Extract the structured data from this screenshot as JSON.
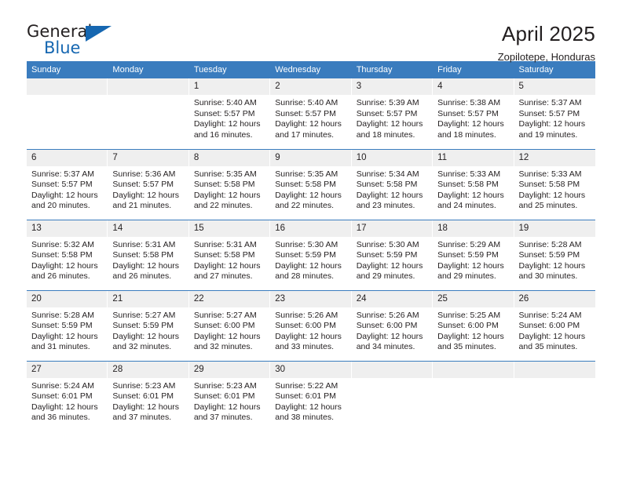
{
  "brand": {
    "name_top": "General",
    "name_bottom": "Blue",
    "accent_color": "#1667b1"
  },
  "header": {
    "title": "April 2025",
    "subtitle": "Zopilotepe, Honduras"
  },
  "theme": {
    "header_blue": "#3a7cbe",
    "daynum_gray": "#efefef",
    "text": "#231f20"
  },
  "calendar": {
    "weekday_headers": [
      "Sunday",
      "Monday",
      "Tuesday",
      "Wednesday",
      "Thursday",
      "Friday",
      "Saturday"
    ],
    "weeks": [
      [
        {
          "day": "",
          "lines": []
        },
        {
          "day": "",
          "lines": []
        },
        {
          "day": "1",
          "lines": [
            "Sunrise: 5:40 AM",
            "Sunset: 5:57 PM",
            "Daylight: 12 hours",
            "and 16 minutes."
          ]
        },
        {
          "day": "2",
          "lines": [
            "Sunrise: 5:40 AM",
            "Sunset: 5:57 PM",
            "Daylight: 12 hours",
            "and 17 minutes."
          ]
        },
        {
          "day": "3",
          "lines": [
            "Sunrise: 5:39 AM",
            "Sunset: 5:57 PM",
            "Daylight: 12 hours",
            "and 18 minutes."
          ]
        },
        {
          "day": "4",
          "lines": [
            "Sunrise: 5:38 AM",
            "Sunset: 5:57 PM",
            "Daylight: 12 hours",
            "and 18 minutes."
          ]
        },
        {
          "day": "5",
          "lines": [
            "Sunrise: 5:37 AM",
            "Sunset: 5:57 PM",
            "Daylight: 12 hours",
            "and 19 minutes."
          ]
        }
      ],
      [
        {
          "day": "6",
          "lines": [
            "Sunrise: 5:37 AM",
            "Sunset: 5:57 PM",
            "Daylight: 12 hours",
            "and 20 minutes."
          ]
        },
        {
          "day": "7",
          "lines": [
            "Sunrise: 5:36 AM",
            "Sunset: 5:57 PM",
            "Daylight: 12 hours",
            "and 21 minutes."
          ]
        },
        {
          "day": "8",
          "lines": [
            "Sunrise: 5:35 AM",
            "Sunset: 5:58 PM",
            "Daylight: 12 hours",
            "and 22 minutes."
          ]
        },
        {
          "day": "9",
          "lines": [
            "Sunrise: 5:35 AM",
            "Sunset: 5:58 PM",
            "Daylight: 12 hours",
            "and 22 minutes."
          ]
        },
        {
          "day": "10",
          "lines": [
            "Sunrise: 5:34 AM",
            "Sunset: 5:58 PM",
            "Daylight: 12 hours",
            "and 23 minutes."
          ]
        },
        {
          "day": "11",
          "lines": [
            "Sunrise: 5:33 AM",
            "Sunset: 5:58 PM",
            "Daylight: 12 hours",
            "and 24 minutes."
          ]
        },
        {
          "day": "12",
          "lines": [
            "Sunrise: 5:33 AM",
            "Sunset: 5:58 PM",
            "Daylight: 12 hours",
            "and 25 minutes."
          ]
        }
      ],
      [
        {
          "day": "13",
          "lines": [
            "Sunrise: 5:32 AM",
            "Sunset: 5:58 PM",
            "Daylight: 12 hours",
            "and 26 minutes."
          ]
        },
        {
          "day": "14",
          "lines": [
            "Sunrise: 5:31 AM",
            "Sunset: 5:58 PM",
            "Daylight: 12 hours",
            "and 26 minutes."
          ]
        },
        {
          "day": "15",
          "lines": [
            "Sunrise: 5:31 AM",
            "Sunset: 5:58 PM",
            "Daylight: 12 hours",
            "and 27 minutes."
          ]
        },
        {
          "day": "16",
          "lines": [
            "Sunrise: 5:30 AM",
            "Sunset: 5:59 PM",
            "Daylight: 12 hours",
            "and 28 minutes."
          ]
        },
        {
          "day": "17",
          "lines": [
            "Sunrise: 5:30 AM",
            "Sunset: 5:59 PM",
            "Daylight: 12 hours",
            "and 29 minutes."
          ]
        },
        {
          "day": "18",
          "lines": [
            "Sunrise: 5:29 AM",
            "Sunset: 5:59 PM",
            "Daylight: 12 hours",
            "and 29 minutes."
          ]
        },
        {
          "day": "19",
          "lines": [
            "Sunrise: 5:28 AM",
            "Sunset: 5:59 PM",
            "Daylight: 12 hours",
            "and 30 minutes."
          ]
        }
      ],
      [
        {
          "day": "20",
          "lines": [
            "Sunrise: 5:28 AM",
            "Sunset: 5:59 PM",
            "Daylight: 12 hours",
            "and 31 minutes."
          ]
        },
        {
          "day": "21",
          "lines": [
            "Sunrise: 5:27 AM",
            "Sunset: 5:59 PM",
            "Daylight: 12 hours",
            "and 32 minutes."
          ]
        },
        {
          "day": "22",
          "lines": [
            "Sunrise: 5:27 AM",
            "Sunset: 6:00 PM",
            "Daylight: 12 hours",
            "and 32 minutes."
          ]
        },
        {
          "day": "23",
          "lines": [
            "Sunrise: 5:26 AM",
            "Sunset: 6:00 PM",
            "Daylight: 12 hours",
            "and 33 minutes."
          ]
        },
        {
          "day": "24",
          "lines": [
            "Sunrise: 5:26 AM",
            "Sunset: 6:00 PM",
            "Daylight: 12 hours",
            "and 34 minutes."
          ]
        },
        {
          "day": "25",
          "lines": [
            "Sunrise: 5:25 AM",
            "Sunset: 6:00 PM",
            "Daylight: 12 hours",
            "and 35 minutes."
          ]
        },
        {
          "day": "26",
          "lines": [
            "Sunrise: 5:24 AM",
            "Sunset: 6:00 PM",
            "Daylight: 12 hours",
            "and 35 minutes."
          ]
        }
      ],
      [
        {
          "day": "27",
          "lines": [
            "Sunrise: 5:24 AM",
            "Sunset: 6:01 PM",
            "Daylight: 12 hours",
            "and 36 minutes."
          ]
        },
        {
          "day": "28",
          "lines": [
            "Sunrise: 5:23 AM",
            "Sunset: 6:01 PM",
            "Daylight: 12 hours",
            "and 37 minutes."
          ]
        },
        {
          "day": "29",
          "lines": [
            "Sunrise: 5:23 AM",
            "Sunset: 6:01 PM",
            "Daylight: 12 hours",
            "and 37 minutes."
          ]
        },
        {
          "day": "30",
          "lines": [
            "Sunrise: 5:22 AM",
            "Sunset: 6:01 PM",
            "Daylight: 12 hours",
            "and 38 minutes."
          ]
        },
        {
          "day": "",
          "lines": []
        },
        {
          "day": "",
          "lines": []
        },
        {
          "day": "",
          "lines": []
        }
      ]
    ]
  }
}
